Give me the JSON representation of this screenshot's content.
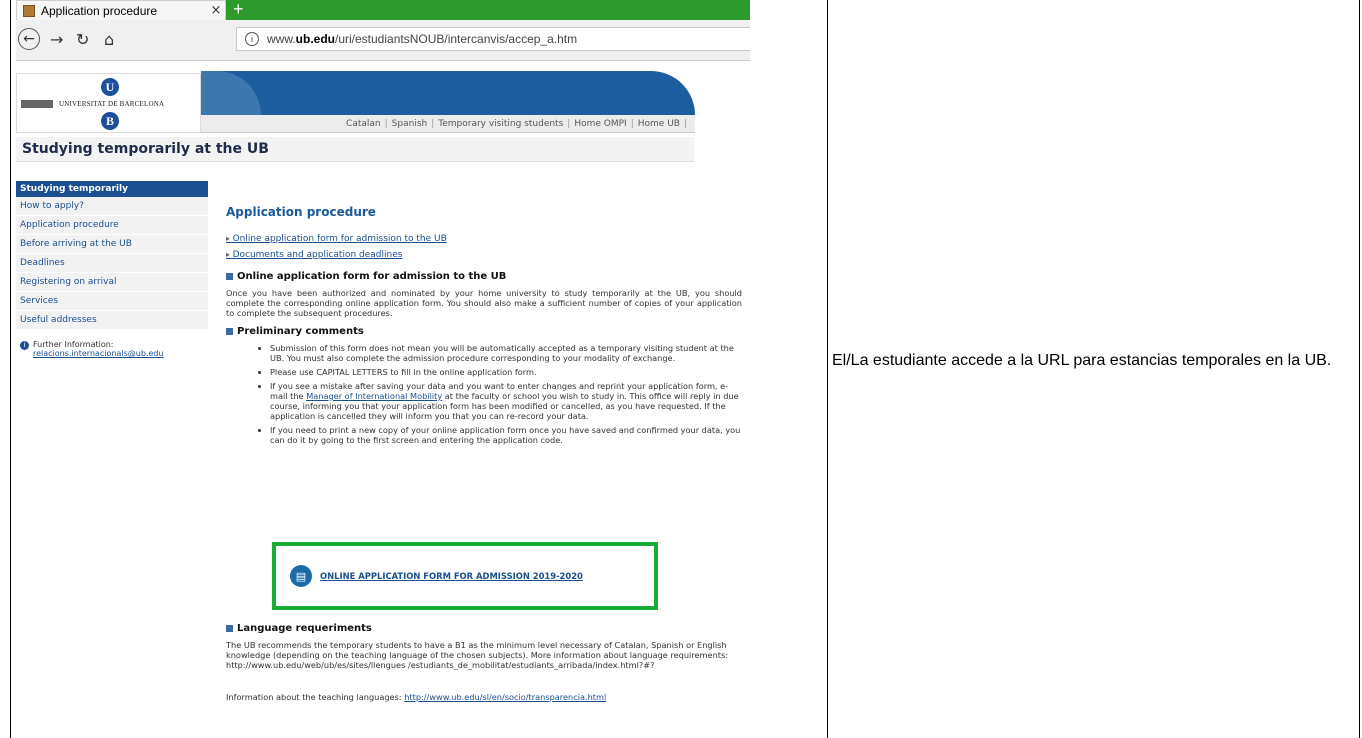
{
  "browser": {
    "tab_title": "Application procedure",
    "tab_close": "×",
    "new_tab": "+",
    "url_prefix": "www.",
    "url_domain": "ub.edu",
    "url_path": "/uri/estudiantsNOUB/intercanvis/accep_a.htm"
  },
  "site": {
    "logo_text": "UNIVERSITAT DE BARCELONA",
    "logo_u": "U",
    "logo_b": "B",
    "top_links": [
      "Catalan",
      "Spanish",
      "Temporary visiting students",
      "Home OMPI",
      "Home UB"
    ],
    "page_heading": "Studying temporarily at the UB"
  },
  "sidebar": {
    "active": "Studying temporarily",
    "items": [
      "How to apply?",
      "Application procedure",
      "Before arriving at the UB",
      "Deadlines",
      "Registering on arrival",
      "Services",
      "Useful addresses"
    ],
    "info_label": "Further Information:",
    "info_email": "relacions.internacionals@ub.edu"
  },
  "main": {
    "title": "Application procedure",
    "toc": [
      "Online application form for admission to the UB",
      "Documents and application deadlines"
    ],
    "section1_title": "Online application form for admission to the UB",
    "section1_text": "Once you have been authorized and nominated by your home university to study temporarily at the UB, you should complete the corresponding online application form. You should also make a sufficient number of copies of your application to complete the subsequent procedures.",
    "section2_title": "Preliminary comments",
    "bullet1": "Submission of this form does not mean you will be automatically accepted as a temporary visiting student at the UB. You must also complete the admission procedure corresponding to your modality of exchange.",
    "bullet2": "Please use CAPITAL LETTERS to fill in the online application form.",
    "bullet3_pre": "If you see a mistake after saving your data and you want to enter changes and reprint your application form, e-mail the ",
    "bullet3_link": "Manager of International Mobility",
    "bullet3_post": " at the faculty or school you wish to study in. This office will reply in due course, informing you that your application form has been modified or cancelled, as you have requested. If the application is cancelled they will inform you that you can re-record your data.",
    "bullet4": "If you need to print a new copy of your online application form once you have saved and confirmed your data, you can do it by going to the first screen and entering the application code.",
    "cta_label": "ONLINE APPLICATION FORM FOR ADMISSION 2019-2020",
    "section3_title": "Language requeriments",
    "section3_text": "The UB recommends the temporary students to have a B1 as the minimum level necessary of Catalan, Spanish or English knowledge (depending on the teaching language of the chosen subjects). More information about language requirements: http://www.ub.edu/web/ub/es/sites/llengues /estudiants_de_mobilitat/estudiants_arribada/index.html?#?",
    "teaching_label": "Information about the teaching languages: ",
    "teaching_link": "http://www.ub.edu/sl/en/socio/transparencia.html"
  },
  "description": "El/La estudiante accede a la URL para estancias temporales en la UB.",
  "colors": {
    "tab_green": "#2c9a2c",
    "ub_blue": "#1b5d9e",
    "highlight_green": "#1aaa3a"
  }
}
